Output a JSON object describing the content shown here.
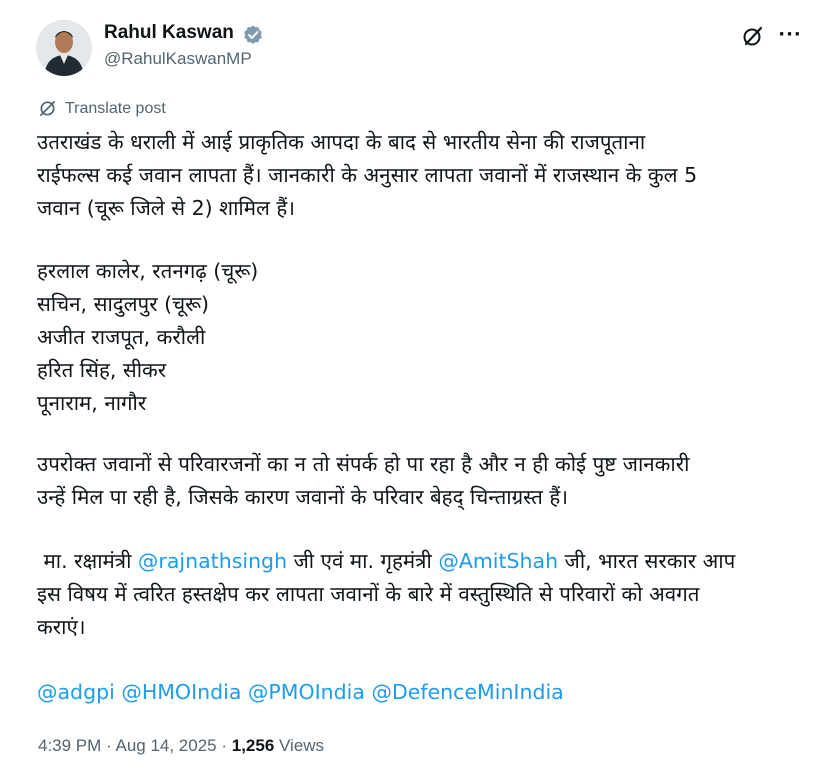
{
  "author": {
    "name": "Rahul Kaswan",
    "handle": "@RahulKaswanMP"
  },
  "icons": {
    "verified": "verified-badge-icon",
    "grok": "grok-icon",
    "more": "more-options-icon",
    "translate": "translate-icon"
  },
  "translate_label": "Translate post",
  "paragraph1": [
    "उतराखंड के धराली में आई प्राकृतिक आपदा के बाद से भारतीय सेना की राजपूताना",
    "राईफल्स कई जवान लापता हैं। जानकारी के अनुसार लापता जवानों में राजस्थान के कुल 5",
    "जवान (चूरू जिले से 2) शामिल हैं।"
  ],
  "names": [
    "हरलाल कालेर, रतनगढ़ (चूरू)",
    "सचिन, सादुलपुर (चूरू)",
    "अजीत राजपूत, करौली",
    "हरित सिंह, सीकर",
    "पूनाराम, नागौर"
  ],
  "paragraph2": [
    "उपरोक्त जवानों से परिवारजनों का न तो संपर्क हो पा रहा है और न ही कोई पुष्ट जानकारी",
    "उन्हें मिल पा रही है, जिसके कारण जवानों के परिवार बेहद् चिन्ताग्रस्त हैं।"
  ],
  "paragraph3": {
    "part1": " मा. रक्षामंत्री ",
    "mention1": "@rajnathsingh",
    "part2": " जी एवं मा. गृहमंत्री ",
    "mention2": "@AmitShah",
    "part3": " जी, भारत सरकार आप",
    "line2": "इस विषय में त्वरित हस्तक्षेप कर लापता जवानों के बारे में वस्तुस्थिति से परिवारों को अवगत",
    "line3": "कराएं।"
  },
  "mentions": [
    "@adgpi",
    "@HMOIndia",
    "@PMOIndia",
    "@DefenceMinIndia"
  ],
  "meta": {
    "time": "4:39 PM",
    "separator": " · ",
    "date": "Aug 14, 2025",
    "views_count": "1,256",
    "views_label": " Views"
  },
  "colors": {
    "link": "#1d9bf0",
    "text": "#0f1419",
    "secondary": "#536471"
  }
}
